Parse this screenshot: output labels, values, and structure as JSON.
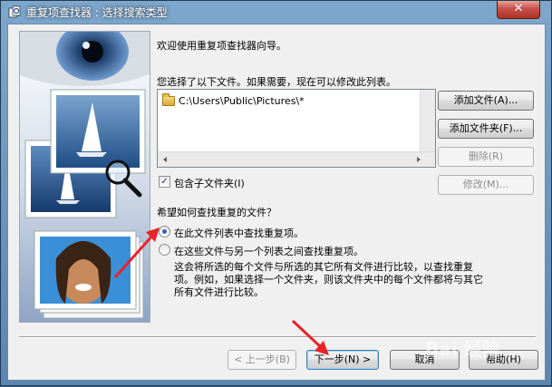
{
  "window": {
    "title": "重复项查找器 : 选择搜索类型",
    "close_label": "✕"
  },
  "intro": "欢迎使用重复项查找器向导。",
  "files_prompt": "您选择了以下文件。如果需要，现在可以修改此列表。",
  "file_list": [
    {
      "path": "C:\\Users\\Public\\Pictures\\*"
    }
  ],
  "buttons": {
    "add_file": "添加文件(A)...",
    "add_folder": "添加文件夹(F)...",
    "remove": "删除(R)",
    "modify": "修改(M)...",
    "back": "< 上一步(B)",
    "next": "下一步(N) >",
    "cancel": "取消",
    "help": "帮助(H)"
  },
  "include_subfolders": {
    "label": "包含子文件夹(I)",
    "checked": true,
    "mark": "✓"
  },
  "search_question": "希望如何查找重复的文件？",
  "options": [
    {
      "label": "在此文件列表中查找重复项。",
      "selected": true
    },
    {
      "label": "在这些文件与另一个列表之间查找重复项。",
      "selected": false
    }
  ],
  "option_description": [
    "这会将所选的每个文件与所选的其它所有文件进行比较，以查找重复",
    "项。例如，如果选择一个文件夹，则该文件夹中的每个文件都将与其它",
    "所有文件进行比较。"
  ],
  "watermark": "Bai 经验",
  "colors": {
    "annotation_arrow": "#e8232a",
    "title_text": "#ffffff"
  }
}
